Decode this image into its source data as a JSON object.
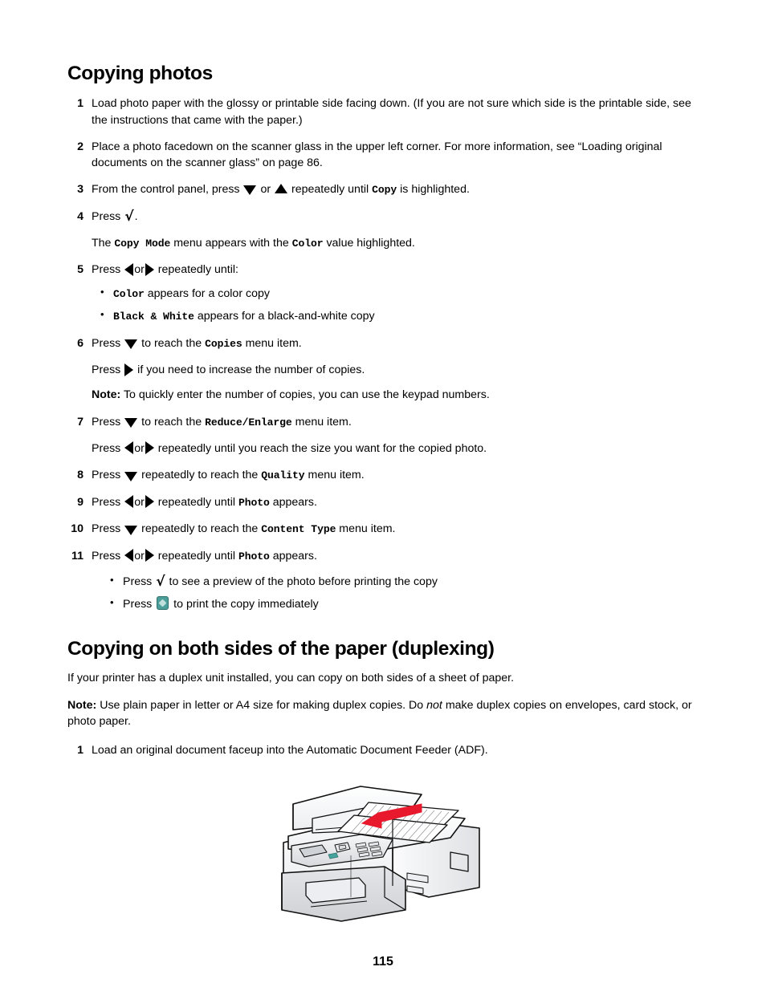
{
  "document": {
    "page_number": "115",
    "sections": [
      {
        "heading": "Copying photos",
        "steps": [
          {
            "number": "1",
            "text": "Load photo paper with the glossy or printable side facing down. (If you are not sure which side is the printable side, see the instructions that came with the paper.)"
          },
          {
            "number": "2",
            "text": "Place a photo facedown on the scanner glass in the upper left corner. For more information, see “Loading original documents on the scanner glass” on page 86."
          },
          {
            "number": "3",
            "text_a": "From the control panel, press",
            "text_b": "or",
            "text_c": "repeatedly until",
            "mono": "Copy",
            "text_d": "is highlighted."
          },
          {
            "number": "4",
            "text_a": "Press",
            "text_b": ".",
            "sub_a": "The",
            "sub_mono_1": "Copy Mode",
            "sub_b": "menu appears with the",
            "sub_mono_2": "Color",
            "sub_c": "value highlighted."
          },
          {
            "number": "5",
            "text_a": "Press",
            "text_b": "or",
            "text_c": "repeatedly until:",
            "bullets": [
              {
                "mono": "Color",
                "text": "appears for a color copy"
              },
              {
                "mono": "Black & White",
                "text": "appears for a black-and-white copy"
              }
            ]
          },
          {
            "number": "6",
            "text_a": "Press",
            "text_b": "to reach the",
            "mono": "Copies",
            "text_c": "menu item.",
            "sub_a": "Press",
            "sub_b": "if you need to increase the number of copies.",
            "note_label": "Note:",
            "note_text": "To quickly enter the number of copies, you can use the keypad numbers."
          },
          {
            "number": "7",
            "text_a": "Press",
            "text_b": "to reach the",
            "mono": "Reduce/Enlarge",
            "text_c": "menu item.",
            "sub_a": "Press",
            "sub_b": "or",
            "sub_c": "repeatedly until you reach the size you want for the copied photo."
          },
          {
            "number": "8",
            "text_a": "Press",
            "text_b": "repeatedly to reach the",
            "mono": "Quality",
            "text_c": "menu item."
          },
          {
            "number": "9",
            "text_a": "Press",
            "text_b": "or",
            "text_c": "repeatedly until",
            "mono": "Photo",
            "text_d": "appears."
          },
          {
            "number": "10",
            "text_a": "Press",
            "text_b": "repeatedly to reach the",
            "mono": "Content Type",
            "text_c": "menu item."
          },
          {
            "number": "11",
            "text_a": "Press",
            "text_b": "or",
            "text_c": "repeatedly until",
            "mono": "Photo",
            "text_d": "appears.",
            "bullets": [
              {
                "pre": "Press",
                "post": "to see a preview of the photo before printing the copy",
                "icon": "check-icon"
              },
              {
                "pre": "Press",
                "post": "to print the copy immediately",
                "icon": "start-button-icon"
              }
            ]
          }
        ]
      },
      {
        "heading": "Copying on both sides of the paper (duplexing)",
        "intro": "If your printer has a duplex unit installed, you can copy on both sides of a sheet of paper.",
        "note_label": "Note:",
        "note_text_a": "Use plain paper in letter or A4 size for making duplex copies. Do",
        "note_italic": "not",
        "note_text_b": "make duplex copies on envelopes, card stock, or photo paper.",
        "steps": [
          {
            "number": "1",
            "text": "Load an original document faceup into the Automatic Document Feeder (ADF)."
          }
        ],
        "figure": {
          "name": "printer-adf-illustration",
          "description": "All-in-one printer with a red arrow showing paper being loaded faceup into the Automatic Document Feeder"
        }
      }
    ]
  },
  "colors": {
    "arrow_red": "#e8192c",
    "start_button_teal": "#4b9e99",
    "printer_body": "#f4f4f4",
    "printer_outline": "#1a1a1a",
    "printer_shade": "#d9dadd"
  }
}
